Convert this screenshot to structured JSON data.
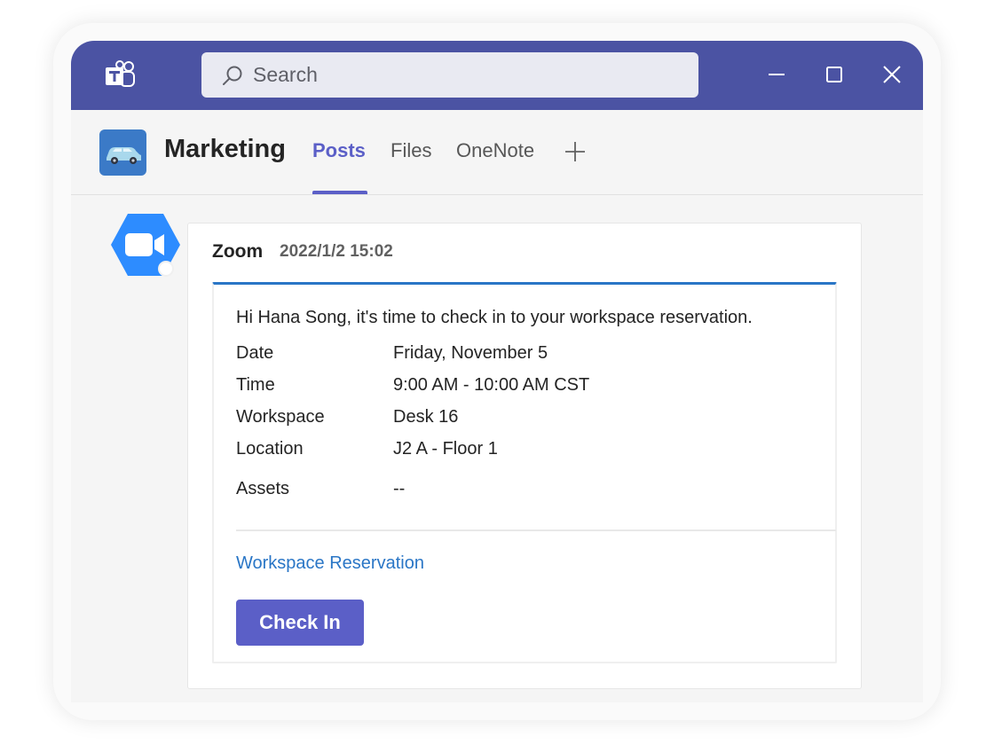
{
  "search": {
    "placeholder": "Search"
  },
  "channel": {
    "name": "Marketing",
    "tabs": [
      {
        "label": "Posts",
        "active": true
      },
      {
        "label": "Files",
        "active": false
      },
      {
        "label": "OneNote",
        "active": false
      }
    ]
  },
  "post": {
    "author": "Zoom",
    "timestamp": "2022/1/2 15:02",
    "card": {
      "intro": "Hi Hana Song, it's time to check in to your workspace reservation.",
      "facts": [
        {
          "label": "Date",
          "value": "Friday, November 5"
        },
        {
          "label": "Time",
          "value": "9:00 AM - 10:00 AM CST"
        },
        {
          "label": "Workspace",
          "value": "Desk 16"
        },
        {
          "label": "Location",
          "value": "J2 A - Floor 1"
        },
        {
          "label": "Assets",
          "value": "--"
        }
      ],
      "link_label": "Workspace Reservation",
      "button_label": "Check In"
    }
  },
  "colors": {
    "titlebar": "#4b53a3",
    "accent": "#5b5fc7",
    "link": "#2a76c6",
    "zoom_brand": "#2d8cff"
  },
  "icons": {
    "app": "teams-icon",
    "search": "search-icon",
    "minimize": "minimize-icon",
    "maximize": "maximize-icon",
    "close": "close-icon",
    "add_tab": "plus-icon",
    "channel_avatar": "car-icon",
    "bot_avatar": "zoom-icon"
  }
}
